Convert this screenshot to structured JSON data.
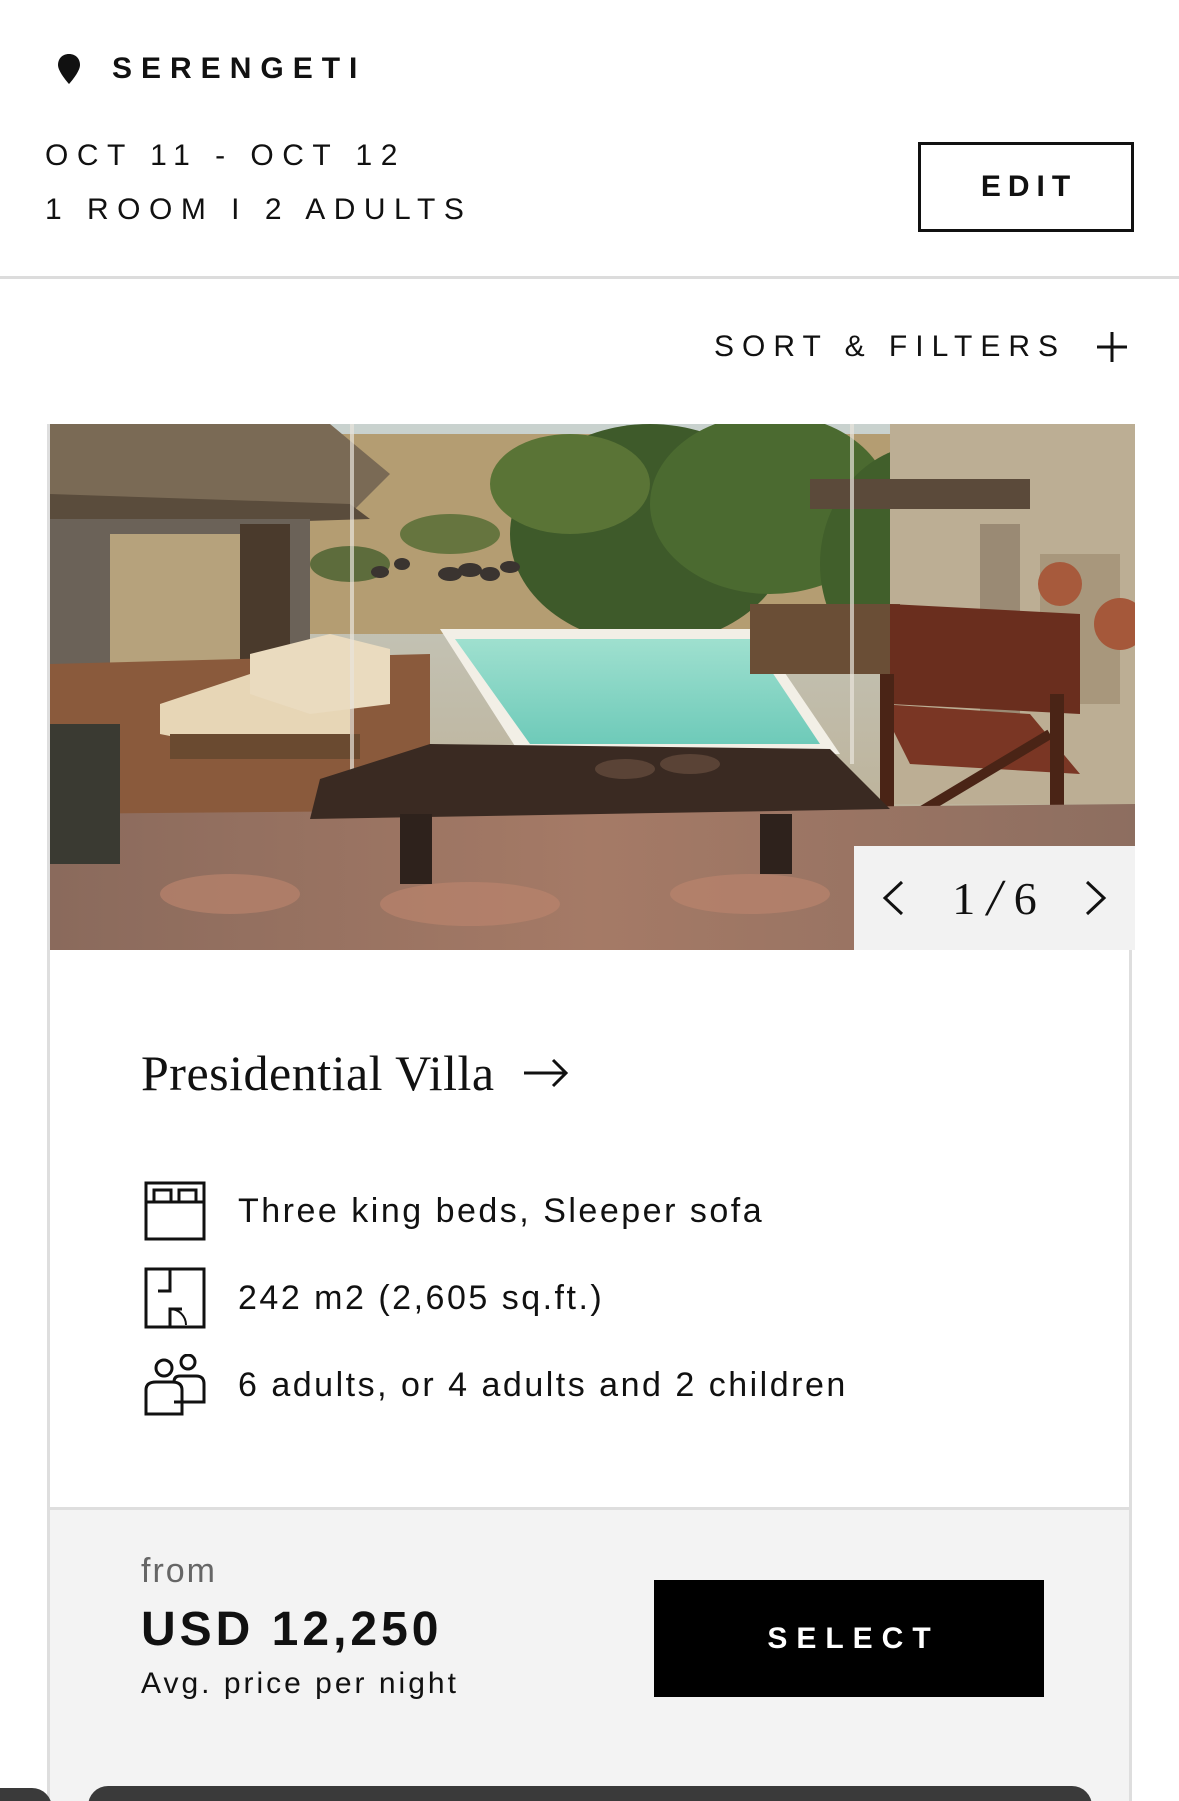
{
  "header": {
    "location": "SERENGETI",
    "location_icon": "location-pin-icon",
    "dates": "OCT 11 - OCT 12",
    "room_info": "1 ROOM I 2 ADULTS",
    "edit_label": "EDIT"
  },
  "filters": {
    "label": "SORT & FILTERS",
    "icon": "plus-icon"
  },
  "room": {
    "gallery": {
      "current": "1",
      "separator": "/",
      "total": "6",
      "prev_icon": "chevron-left-icon",
      "next_icon": "chevron-right-icon"
    },
    "name": "Presidential Villa",
    "features": [
      {
        "icon": "bed-icon",
        "text": "Three king beds, Sleeper sofa"
      },
      {
        "icon": "floorplan-icon",
        "text": "242 m2 (2,605 sq.ft.)"
      },
      {
        "icon": "guests-icon",
        "text": "6 adults, or 4 adults and 2 children"
      }
    ],
    "price": {
      "prefix": "from",
      "amount": "USD 12,250",
      "note": "Avg. price per night"
    },
    "select_label": "SELECT"
  },
  "colors": {
    "text": "#111111",
    "button_bg": "#000000",
    "panel_bg": "#f3f3f3",
    "divider": "#dcdcdc"
  }
}
